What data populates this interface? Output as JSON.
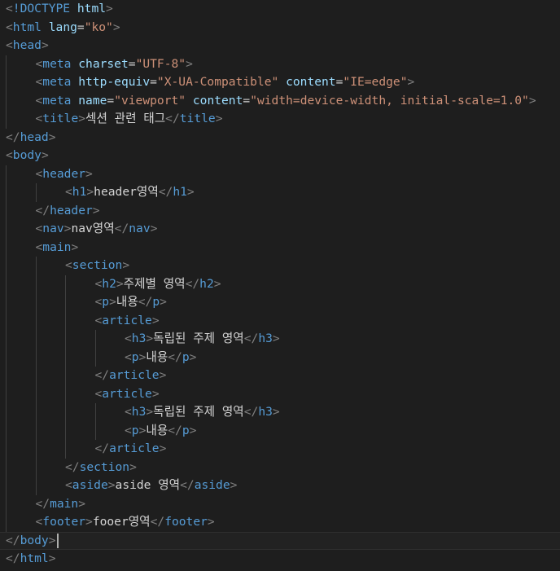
{
  "editor": {
    "language": "html",
    "colors": {
      "background": "#1e1e1e",
      "punctuation": "#808080",
      "tag": "#569cd6",
      "attribute": "#9cdcfe",
      "string": "#ce9178",
      "text": "#d4d4d4"
    },
    "lines": [
      {
        "indent": 0,
        "tokens": [
          [
            "punc",
            "<"
          ],
          [
            "doc",
            "!DOCTYPE"
          ],
          [
            "text",
            " "
          ],
          [
            "attr",
            "html"
          ],
          [
            "punc",
            ">"
          ]
        ]
      },
      {
        "indent": 0,
        "tokens": [
          [
            "punc",
            "<"
          ],
          [
            "tag",
            "html"
          ],
          [
            "text",
            " "
          ],
          [
            "attr",
            "lang"
          ],
          [
            "text",
            "="
          ],
          [
            "str",
            "\"ko\""
          ],
          [
            "punc",
            ">"
          ]
        ]
      },
      {
        "indent": 0,
        "tokens": [
          [
            "punc",
            "<"
          ],
          [
            "tag",
            "head"
          ],
          [
            "punc",
            ">"
          ]
        ]
      },
      {
        "indent": 1,
        "tokens": [
          [
            "punc",
            "<"
          ],
          [
            "tag",
            "meta"
          ],
          [
            "text",
            " "
          ],
          [
            "attr",
            "charset"
          ],
          [
            "text",
            "="
          ],
          [
            "str",
            "\"UTF-8\""
          ],
          [
            "punc",
            ">"
          ]
        ]
      },
      {
        "indent": 1,
        "tokens": [
          [
            "punc",
            "<"
          ],
          [
            "tag",
            "meta"
          ],
          [
            "text",
            " "
          ],
          [
            "attr",
            "http-equiv"
          ],
          [
            "text",
            "="
          ],
          [
            "str",
            "\"X-UA-Compatible\""
          ],
          [
            "text",
            " "
          ],
          [
            "attr",
            "content"
          ],
          [
            "text",
            "="
          ],
          [
            "str",
            "\"IE=edge\""
          ],
          [
            "punc",
            ">"
          ]
        ]
      },
      {
        "indent": 1,
        "tokens": [
          [
            "punc",
            "<"
          ],
          [
            "tag",
            "meta"
          ],
          [
            "text",
            " "
          ],
          [
            "attr",
            "name"
          ],
          [
            "text",
            "="
          ],
          [
            "str",
            "\"viewport\""
          ],
          [
            "text",
            " "
          ],
          [
            "attr",
            "content"
          ],
          [
            "text",
            "="
          ],
          [
            "str",
            "\"width=device-width, initial-scale=1.0\""
          ],
          [
            "punc",
            ">"
          ]
        ]
      },
      {
        "indent": 1,
        "tokens": [
          [
            "punc",
            "<"
          ],
          [
            "tag",
            "title"
          ],
          [
            "punc",
            ">"
          ],
          [
            "text",
            "섹션 관련 태그"
          ],
          [
            "punc",
            "</"
          ],
          [
            "tag",
            "title"
          ],
          [
            "punc",
            ">"
          ]
        ]
      },
      {
        "indent": 0,
        "tokens": [
          [
            "punc",
            "</"
          ],
          [
            "tag",
            "head"
          ],
          [
            "punc",
            ">"
          ]
        ]
      },
      {
        "indent": 0,
        "tokens": [
          [
            "punc",
            "<"
          ],
          [
            "tag",
            "body"
          ],
          [
            "punc",
            ">"
          ]
        ]
      },
      {
        "indent": 1,
        "tokens": [
          [
            "punc",
            "<"
          ],
          [
            "tag",
            "header"
          ],
          [
            "punc",
            ">"
          ]
        ]
      },
      {
        "indent": 2,
        "tokens": [
          [
            "punc",
            "<"
          ],
          [
            "tag",
            "h1"
          ],
          [
            "punc",
            ">"
          ],
          [
            "text",
            "header영역"
          ],
          [
            "punc",
            "</"
          ],
          [
            "tag",
            "h1"
          ],
          [
            "punc",
            ">"
          ]
        ]
      },
      {
        "indent": 1,
        "tokens": [
          [
            "punc",
            "</"
          ],
          [
            "tag",
            "header"
          ],
          [
            "punc",
            ">"
          ]
        ]
      },
      {
        "indent": 1,
        "tokens": [
          [
            "punc",
            "<"
          ],
          [
            "tag",
            "nav"
          ],
          [
            "punc",
            ">"
          ],
          [
            "text",
            "nav영역"
          ],
          [
            "punc",
            "</"
          ],
          [
            "tag",
            "nav"
          ],
          [
            "punc",
            ">"
          ]
        ]
      },
      {
        "indent": 1,
        "tokens": [
          [
            "punc",
            "<"
          ],
          [
            "tag",
            "main"
          ],
          [
            "punc",
            ">"
          ]
        ]
      },
      {
        "indent": 2,
        "tokens": [
          [
            "punc",
            "<"
          ],
          [
            "tag",
            "section"
          ],
          [
            "punc",
            ">"
          ]
        ]
      },
      {
        "indent": 3,
        "tokens": [
          [
            "punc",
            "<"
          ],
          [
            "tag",
            "h2"
          ],
          [
            "punc",
            ">"
          ],
          [
            "text",
            "주제별 영역"
          ],
          [
            "punc",
            "</"
          ],
          [
            "tag",
            "h2"
          ],
          [
            "punc",
            ">"
          ]
        ]
      },
      {
        "indent": 3,
        "tokens": [
          [
            "punc",
            "<"
          ],
          [
            "tag",
            "p"
          ],
          [
            "punc",
            ">"
          ],
          [
            "text",
            "내용"
          ],
          [
            "punc",
            "</"
          ],
          [
            "tag",
            "p"
          ],
          [
            "punc",
            ">"
          ]
        ]
      },
      {
        "indent": 3,
        "tokens": [
          [
            "punc",
            "<"
          ],
          [
            "tag",
            "article"
          ],
          [
            "punc",
            ">"
          ]
        ]
      },
      {
        "indent": 4,
        "tokens": [
          [
            "punc",
            "<"
          ],
          [
            "tag",
            "h3"
          ],
          [
            "punc",
            ">"
          ],
          [
            "text",
            "독립된 주제 영역"
          ],
          [
            "punc",
            "</"
          ],
          [
            "tag",
            "h3"
          ],
          [
            "punc",
            ">"
          ]
        ]
      },
      {
        "indent": 4,
        "tokens": [
          [
            "punc",
            "<"
          ],
          [
            "tag",
            "p"
          ],
          [
            "punc",
            ">"
          ],
          [
            "text",
            "내용"
          ],
          [
            "punc",
            "</"
          ],
          [
            "tag",
            "p"
          ],
          [
            "punc",
            ">"
          ]
        ]
      },
      {
        "indent": 3,
        "tokens": [
          [
            "punc",
            "</"
          ],
          [
            "tag",
            "article"
          ],
          [
            "punc",
            ">"
          ]
        ]
      },
      {
        "indent": 3,
        "tokens": [
          [
            "punc",
            "<"
          ],
          [
            "tag",
            "article"
          ],
          [
            "punc",
            ">"
          ]
        ]
      },
      {
        "indent": 4,
        "tokens": [
          [
            "punc",
            "<"
          ],
          [
            "tag",
            "h3"
          ],
          [
            "punc",
            ">"
          ],
          [
            "text",
            "독립된 주제 영역"
          ],
          [
            "punc",
            "</"
          ],
          [
            "tag",
            "h3"
          ],
          [
            "punc",
            ">"
          ]
        ]
      },
      {
        "indent": 4,
        "tokens": [
          [
            "punc",
            "<"
          ],
          [
            "tag",
            "p"
          ],
          [
            "punc",
            ">"
          ],
          [
            "text",
            "내용"
          ],
          [
            "punc",
            "</"
          ],
          [
            "tag",
            "p"
          ],
          [
            "punc",
            ">"
          ]
        ]
      },
      {
        "indent": 3,
        "tokens": [
          [
            "punc",
            "</"
          ],
          [
            "tag",
            "article"
          ],
          [
            "punc",
            ">"
          ]
        ]
      },
      {
        "indent": 2,
        "tokens": [
          [
            "punc",
            "</"
          ],
          [
            "tag",
            "section"
          ],
          [
            "punc",
            ">"
          ]
        ]
      },
      {
        "indent": 2,
        "tokens": [
          [
            "punc",
            "<"
          ],
          [
            "tag",
            "aside"
          ],
          [
            "punc",
            ">"
          ],
          [
            "text",
            "aside 영역"
          ],
          [
            "punc",
            "</"
          ],
          [
            "tag",
            "aside"
          ],
          [
            "punc",
            ">"
          ]
        ]
      },
      {
        "indent": 1,
        "tokens": [
          [
            "punc",
            "</"
          ],
          [
            "tag",
            "main"
          ],
          [
            "punc",
            ">"
          ]
        ]
      },
      {
        "indent": 1,
        "tokens": [
          [
            "punc",
            "<"
          ],
          [
            "tag",
            "footer"
          ],
          [
            "punc",
            ">"
          ],
          [
            "text",
            "fooer영역"
          ],
          [
            "punc",
            "</"
          ],
          [
            "tag",
            "footer"
          ],
          [
            "punc",
            ">"
          ]
        ]
      },
      {
        "indent": 0,
        "current": true,
        "tokens": [
          [
            "punc",
            "</"
          ],
          [
            "tag",
            "body"
          ],
          [
            "punc",
            ">"
          ]
        ]
      },
      {
        "indent": 0,
        "tokens": [
          [
            "punc",
            "</"
          ],
          [
            "tag",
            "html"
          ],
          [
            "punc",
            ">"
          ]
        ]
      }
    ]
  }
}
